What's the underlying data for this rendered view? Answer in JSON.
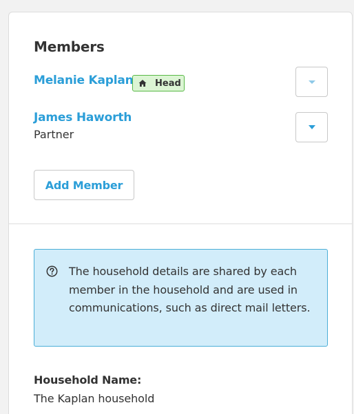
{
  "members_section": {
    "title": "Members",
    "members": [
      {
        "name": "Melanie Kaplan",
        "badge": "Head",
        "role": ""
      },
      {
        "name": "James Haworth",
        "badge": "",
        "role": "Partner"
      }
    ],
    "add_member_label": "Add Member"
  },
  "household_details": {
    "info_text": "The household details are shared by each member in the household and are used in communications, such as direct mail letters.",
    "name_label": "Household Name:",
    "name_value": "The Kaplan household"
  },
  "icons": {
    "badge_icon": "home-icon",
    "info_icon": "question-circle-icon",
    "dropdown_icon": "caret-down-icon"
  },
  "colors": {
    "link": "#2b9ed8",
    "badge_bg": "#dcf5d4",
    "badge_border": "#57b845",
    "info_bg": "#d2edfa",
    "info_border": "#4aaed7",
    "caret_active": "#2b9ed8",
    "caret_muted": "#8ec9e8"
  }
}
